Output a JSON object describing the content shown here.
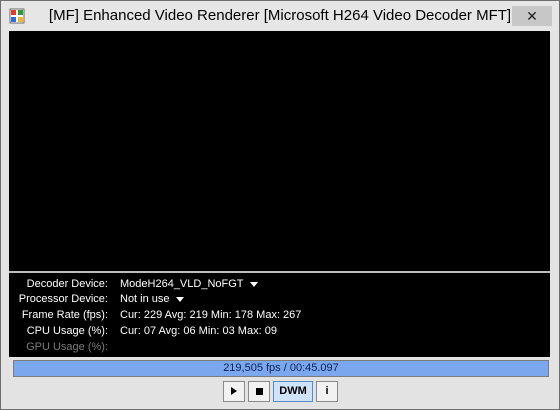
{
  "window": {
    "title": "[MF]  Enhanced Video Renderer  [Microsoft H264 Video Decoder MFT]",
    "close_glyph": "✕"
  },
  "info": {
    "rows": [
      {
        "label": "Decoder Device:",
        "value": "ModeH264_VLD_NoFGT",
        "dropdown": true,
        "enabled": true
      },
      {
        "label": "Processor Device:",
        "value": "Not in use",
        "dropdown": true,
        "enabled": true
      },
      {
        "label": "Frame Rate (fps):",
        "value": "Cur: 229  Avg: 219  Min: 178  Max: 267",
        "dropdown": false,
        "enabled": true
      },
      {
        "label": "CPU Usage (%):",
        "value": "Cur: 07  Avg: 06  Min: 03  Max: 09",
        "dropdown": false,
        "enabled": true
      },
      {
        "label": "GPU Usage (%):",
        "value": "",
        "dropdown": false,
        "enabled": false
      }
    ]
  },
  "progress": {
    "text": "219,505 fps / 00:45.097",
    "fraction": 1.0,
    "color": "#7aa7ee"
  },
  "controls": {
    "play_icon": "play-icon",
    "stop_icon": "stop-icon",
    "dwm_label": "DWM",
    "info_label": "i"
  }
}
